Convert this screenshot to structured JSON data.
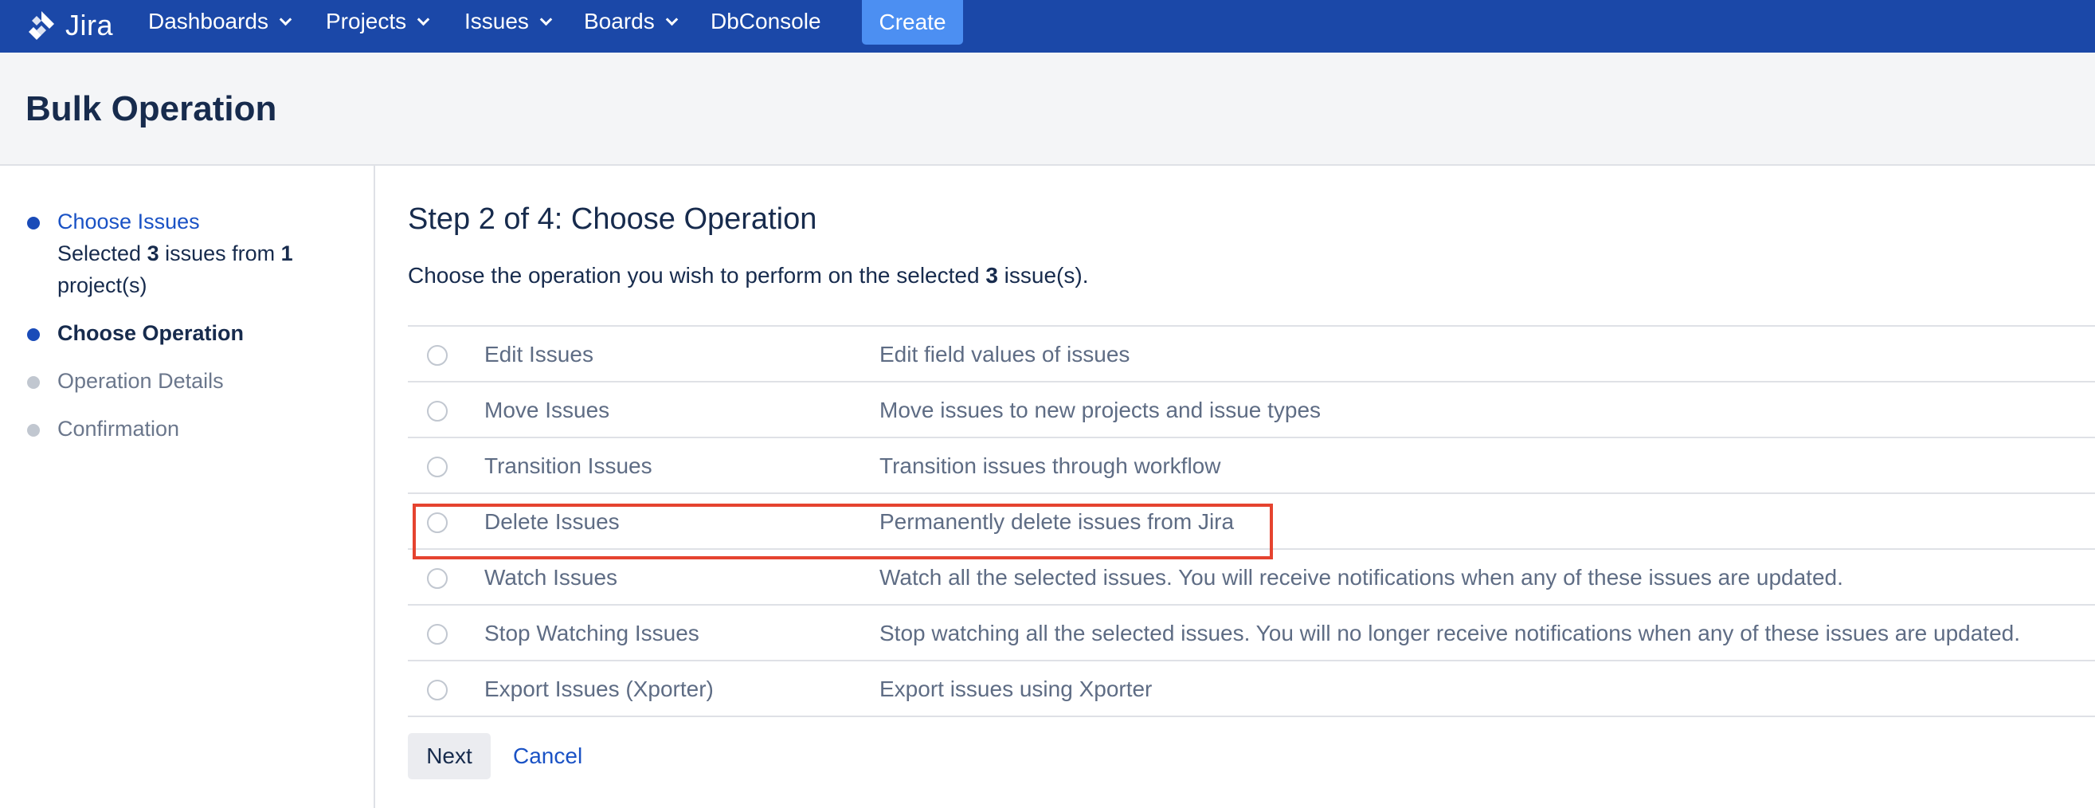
{
  "topnav": {
    "logo_text": "Jira",
    "items": [
      {
        "label": "Dashboards"
      },
      {
        "label": "Projects"
      },
      {
        "label": "Issues"
      },
      {
        "label": "Boards"
      },
      {
        "label": "DbConsole"
      }
    ],
    "create_label": "Create"
  },
  "page": {
    "title": "Bulk Operation"
  },
  "sidebar": {
    "steps": [
      {
        "label": "Choose Issues",
        "sub_prefix": "Selected ",
        "sub_count": "3",
        "sub_mid": " issues from ",
        "sub_projects": "1",
        "sub_suffix": " project(s)"
      },
      {
        "label": "Choose Operation"
      },
      {
        "label": "Operation Details"
      },
      {
        "label": "Confirmation"
      }
    ]
  },
  "main": {
    "title": "Step 2 of 4: Choose Operation",
    "desc_prefix": "Choose the operation you wish to perform on the selected ",
    "desc_count": "3",
    "desc_suffix": " issue(s).",
    "operations": [
      {
        "name": "Edit Issues",
        "description": "Edit field values of issues"
      },
      {
        "name": "Move Issues",
        "description": "Move issues to new projects and issue types"
      },
      {
        "name": "Transition Issues",
        "description": "Transition issues through workflow"
      },
      {
        "name": "Delete Issues",
        "description": "Permanently delete issues from Jira"
      },
      {
        "name": "Watch Issues",
        "description": "Watch all the selected issues. You will receive notifications when any of these issues are updated."
      },
      {
        "name": "Stop Watching Issues",
        "description": "Stop watching all the selected issues. You will no longer receive notifications when any of these issues are updated."
      },
      {
        "name": "Export Issues (Xporter)",
        "description": "Export issues using Xporter"
      }
    ],
    "next_label": "Next",
    "cancel_label": "Cancel"
  },
  "colors": {
    "nav_bg": "#1b48a8",
    "create_bg": "#4c8ff2",
    "link": "#1a52c5",
    "highlight_border": "#e5432f"
  }
}
